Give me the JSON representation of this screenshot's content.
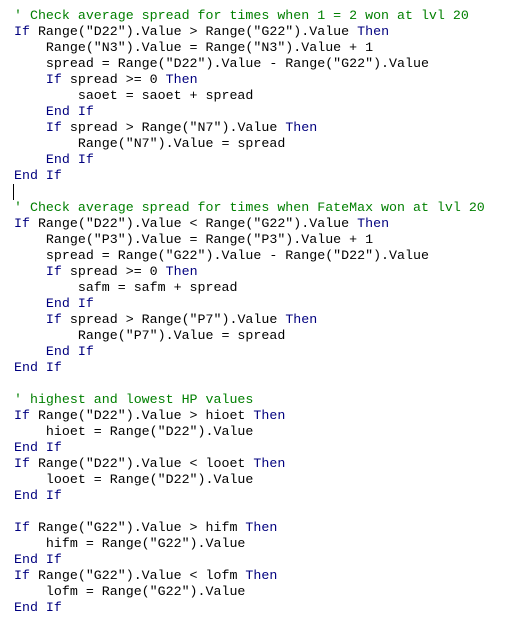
{
  "editor": {
    "language": "VBA",
    "colors": {
      "keyword": "#00007f",
      "comment": "#007f00",
      "text": "#000000",
      "background": "#ffffff"
    },
    "caret_line": 12,
    "lines": [
      [
        {
          "t": "cm",
          "v": "' Check average spread for times when 1 = 2 won at lvl 20"
        }
      ],
      [
        {
          "t": "kw",
          "v": "If"
        },
        {
          "t": "tx",
          "v": " Range(\"D22\").Value > Range(\"G22\").Value "
        },
        {
          "t": "kw",
          "v": "Then"
        }
      ],
      [
        {
          "t": "tx",
          "v": "    Range(\"N3\").Value = Range(\"N3\").Value + 1"
        }
      ],
      [
        {
          "t": "tx",
          "v": "    spread = Range(\"D22\").Value - Range(\"G22\").Value"
        }
      ],
      [
        {
          "t": "tx",
          "v": "    "
        },
        {
          "t": "kw",
          "v": "If"
        },
        {
          "t": "tx",
          "v": " spread >= 0 "
        },
        {
          "t": "kw",
          "v": "Then"
        }
      ],
      [
        {
          "t": "tx",
          "v": "        saoet = saoet + spread"
        }
      ],
      [
        {
          "t": "tx",
          "v": "    "
        },
        {
          "t": "kw",
          "v": "End If"
        }
      ],
      [
        {
          "t": "tx",
          "v": "    "
        },
        {
          "t": "kw",
          "v": "If"
        },
        {
          "t": "tx",
          "v": " spread > Range(\"N7\").Value "
        },
        {
          "t": "kw",
          "v": "Then"
        }
      ],
      [
        {
          "t": "tx",
          "v": "        Range(\"N7\").Value = spread"
        }
      ],
      [
        {
          "t": "tx",
          "v": "    "
        },
        {
          "t": "kw",
          "v": "End If"
        }
      ],
      [
        {
          "t": "kw",
          "v": "End If"
        }
      ],
      [],
      [
        {
          "t": "cm",
          "v": "' Check average spread for times when FateMax won at lvl 20"
        }
      ],
      [
        {
          "t": "kw",
          "v": "If"
        },
        {
          "t": "tx",
          "v": " Range(\"D22\").Value < Range(\"G22\").Value "
        },
        {
          "t": "kw",
          "v": "Then"
        }
      ],
      [
        {
          "t": "tx",
          "v": "    Range(\"P3\").Value = Range(\"P3\").Value + 1"
        }
      ],
      [
        {
          "t": "tx",
          "v": "    spread = Range(\"G22\").Value - Range(\"D22\").Value"
        }
      ],
      [
        {
          "t": "tx",
          "v": "    "
        },
        {
          "t": "kw",
          "v": "If"
        },
        {
          "t": "tx",
          "v": " spread >= 0 "
        },
        {
          "t": "kw",
          "v": "Then"
        }
      ],
      [
        {
          "t": "tx",
          "v": "        safm = safm + spread"
        }
      ],
      [
        {
          "t": "tx",
          "v": "    "
        },
        {
          "t": "kw",
          "v": "End If"
        }
      ],
      [
        {
          "t": "tx",
          "v": "    "
        },
        {
          "t": "kw",
          "v": "If"
        },
        {
          "t": "tx",
          "v": " spread > Range(\"P7\").Value "
        },
        {
          "t": "kw",
          "v": "Then"
        }
      ],
      [
        {
          "t": "tx",
          "v": "        Range(\"P7\").Value = spread"
        }
      ],
      [
        {
          "t": "tx",
          "v": "    "
        },
        {
          "t": "kw",
          "v": "End If"
        }
      ],
      [
        {
          "t": "kw",
          "v": "End If"
        }
      ],
      [],
      [
        {
          "t": "cm",
          "v": "' highest and lowest HP values"
        }
      ],
      [
        {
          "t": "kw",
          "v": "If"
        },
        {
          "t": "tx",
          "v": " Range(\"D22\").Value > hioet "
        },
        {
          "t": "kw",
          "v": "Then"
        }
      ],
      [
        {
          "t": "tx",
          "v": "    hioet = Range(\"D22\").Value"
        }
      ],
      [
        {
          "t": "kw",
          "v": "End If"
        }
      ],
      [
        {
          "t": "kw",
          "v": "If"
        },
        {
          "t": "tx",
          "v": " Range(\"D22\").Value < looet "
        },
        {
          "t": "kw",
          "v": "Then"
        }
      ],
      [
        {
          "t": "tx",
          "v": "    looet = Range(\"D22\").Value"
        }
      ],
      [
        {
          "t": "kw",
          "v": "End If"
        }
      ],
      [],
      [
        {
          "t": "kw",
          "v": "If"
        },
        {
          "t": "tx",
          "v": " Range(\"G22\").Value > hifm "
        },
        {
          "t": "kw",
          "v": "Then"
        }
      ],
      [
        {
          "t": "tx",
          "v": "    hifm = Range(\"G22\").Value"
        }
      ],
      [
        {
          "t": "kw",
          "v": "End If"
        }
      ],
      [
        {
          "t": "kw",
          "v": "If"
        },
        {
          "t": "tx",
          "v": " Range(\"G22\").Value < lofm "
        },
        {
          "t": "kw",
          "v": "Then"
        }
      ],
      [
        {
          "t": "tx",
          "v": "    lofm = Range(\"G22\").Value"
        }
      ],
      [
        {
          "t": "kw",
          "v": "End If"
        }
      ]
    ]
  }
}
